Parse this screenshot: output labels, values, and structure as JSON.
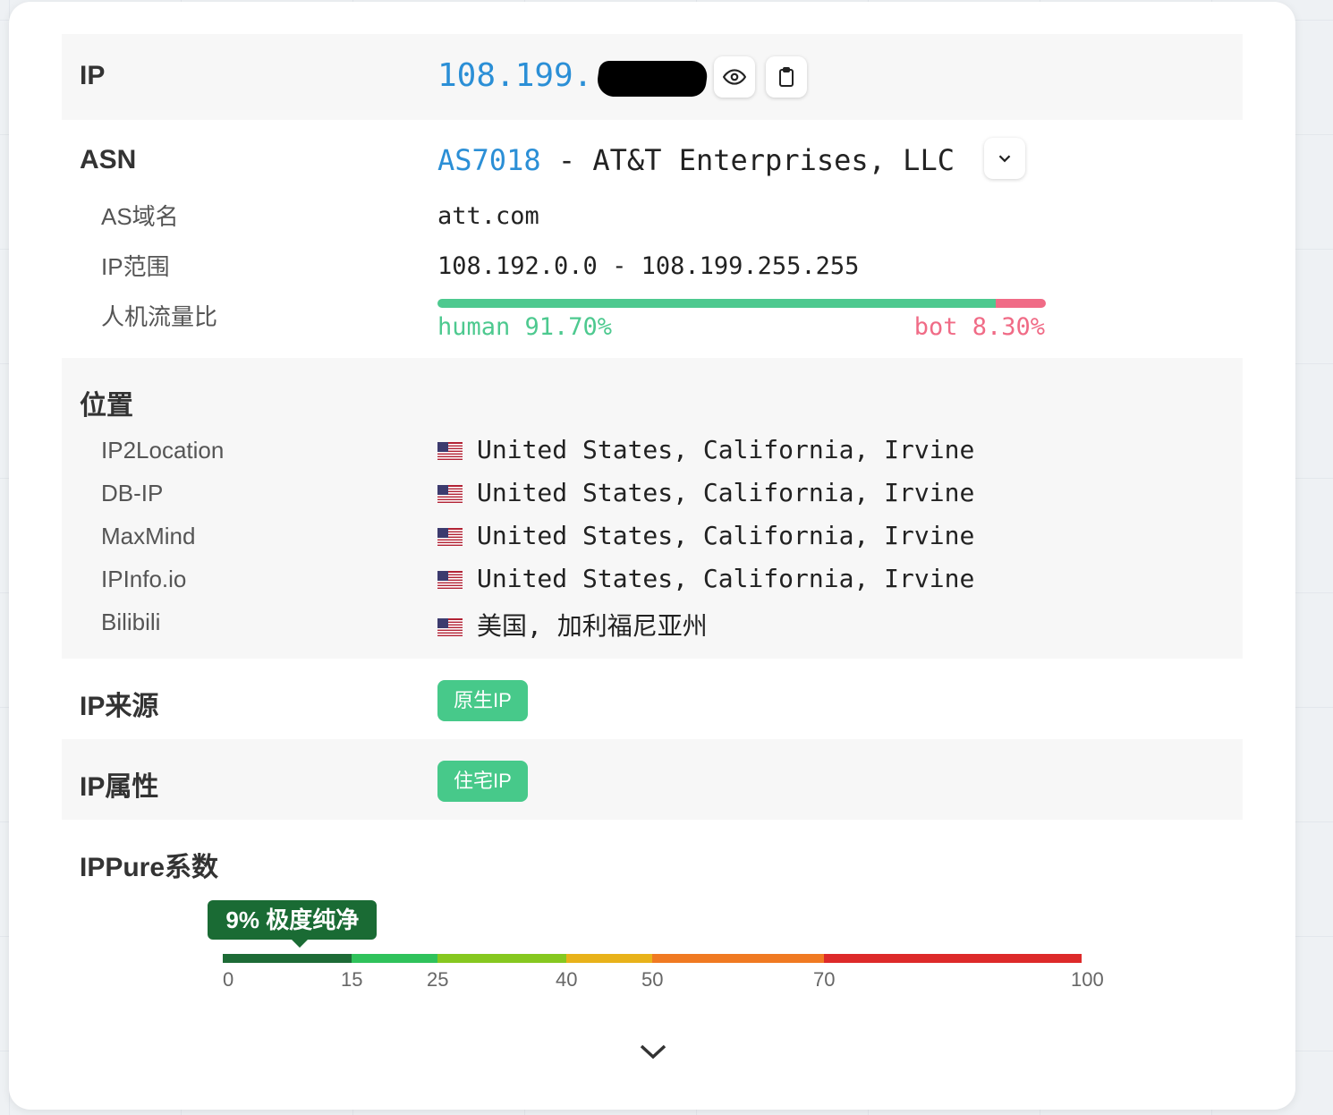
{
  "ip": {
    "label": "IP",
    "value_visible": "108.199."
  },
  "asn": {
    "label": "ASN",
    "as_number": "AS7018",
    "as_name": "- AT&T Enterprises, LLC",
    "domain_label": "AS域名",
    "domain": "att.com",
    "range_label": "IP范围",
    "range": "108.192.0.0 - 108.199.255.255",
    "ratio_label": "人机流量比",
    "human_text": "human 91.70%",
    "bot_text": "bot 8.30%",
    "human_fraction": 0.917,
    "bot_fraction": 0.083,
    "human_color": "#4dc98f",
    "bot_color": "#f06b86"
  },
  "location": {
    "label": "位置",
    "rows": [
      {
        "source": "IP2Location",
        "value": "United States, California, Irvine"
      },
      {
        "source": "DB-IP",
        "value": "United States, California, Irvine"
      },
      {
        "source": "MaxMind",
        "value": "United States, California, Irvine"
      },
      {
        "source": "IPInfo.io",
        "value": "United States, California, Irvine"
      },
      {
        "source": "Bilibili",
        "value": "美国, 加利福尼亚州"
      }
    ]
  },
  "source": {
    "label": "IP来源",
    "badge": "原生IP"
  },
  "attribute": {
    "label": "IP属性",
    "badge": "住宅IP"
  },
  "ippure": {
    "label": "IPPure系数",
    "score": 9,
    "tooltip": "9% 极度纯净",
    "tooltip_color": "#1a6b34",
    "scale_ticks": [
      "0",
      "15",
      "25",
      "40",
      "50",
      "70",
      "100"
    ],
    "segment_colors": [
      "#1d6b36",
      "#2fc25b",
      "#86c820",
      "#e8b21a",
      "#f07a22",
      "#dd2a2a"
    ]
  },
  "colors": {
    "link": "#2b8fd6",
    "badge": "#47c98a"
  },
  "icons": [
    "eye-icon",
    "clipboard-icon",
    "chevron-down-icon",
    "us-flag-icon",
    "expand-chevron-icon"
  ]
}
